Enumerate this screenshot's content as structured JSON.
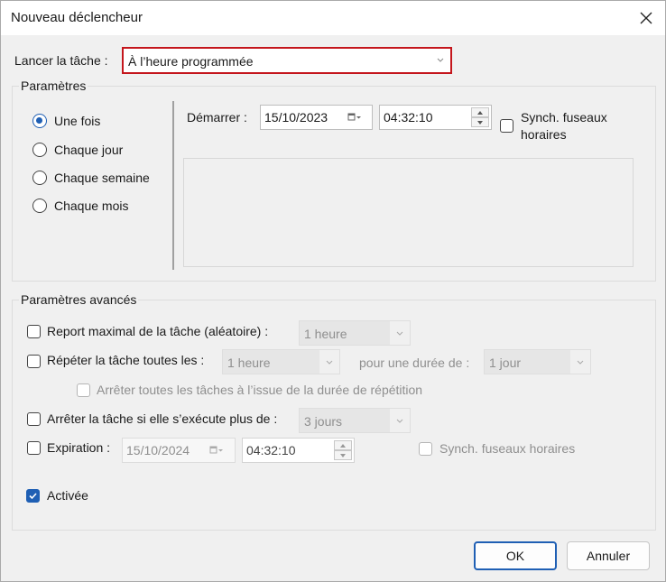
{
  "window": {
    "title": "Nouveau déclencheur"
  },
  "launch": {
    "label": "Lancer la tâche :",
    "value": "À l’heure programmée"
  },
  "settings": {
    "title": "Paramètres",
    "options": [
      "Une fois",
      "Chaque jour",
      "Chaque semaine",
      "Chaque mois"
    ],
    "selected": "Une fois",
    "start_label": "Démarrer :",
    "start_date": "15/10/2023",
    "start_time": "04:32:10",
    "sync_label_1": "Synch. fuseaux",
    "sync_label_2": "horaires"
  },
  "advanced": {
    "title": "Paramètres avancés",
    "delay_label": "Report maximal de la tâche (aléatoire) :",
    "delay_value": "1 heure",
    "repeat_label": "Répéter la tâche toutes les :",
    "repeat_value": "1 heure",
    "duration_label": "pour une durée de :",
    "duration_value": "1 jour",
    "stop_all_label": "Arrêter toutes les tâches à l’issue de la durée de répétition",
    "stop_if_label": "Arrêter la tâche si elle s’exécute plus de :",
    "stop_if_value": "3 jours",
    "expire_label": "Expiration :",
    "expire_date": "15/10/2024",
    "expire_time": "04:32:10",
    "expire_sync_label": "Synch. fuseaux horaires",
    "enabled_label": "Activée"
  },
  "buttons": {
    "ok": "OK",
    "cancel": "Annuler"
  },
  "colors": {
    "accent": "#1f5fb4",
    "highlight_border": "#c4161c"
  }
}
